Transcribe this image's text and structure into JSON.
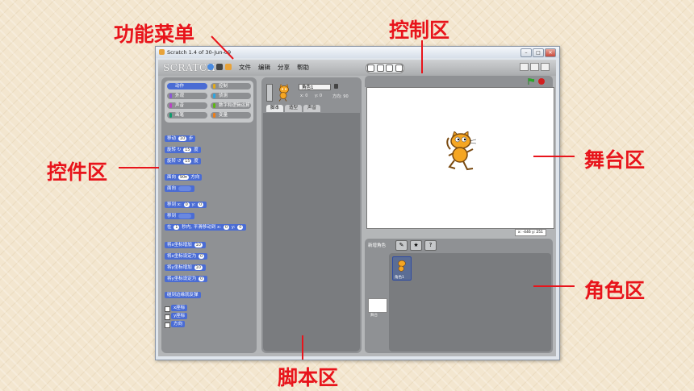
{
  "callouts": {
    "menu": "功能菜单",
    "control": "控制区",
    "blocks": "控件区",
    "stage": "舞台区",
    "sprites": "角色区",
    "scripts": "脚本区"
  },
  "window": {
    "title": "Scratch 1.4 of 30-Jun-09",
    "logo": "SCRATCH"
  },
  "menu": [
    "文件",
    "编辑",
    "分享",
    "帮助"
  ],
  "categories": [
    {
      "label": "动作",
      "color": "#4a6cd4",
      "selected": true
    },
    {
      "label": "控制",
      "color": "#e1a91a",
      "selected": false
    },
    {
      "label": "外观",
      "color": "#8a55d7",
      "selected": false
    },
    {
      "label": "侦测",
      "color": "#2ca5e2",
      "selected": false
    },
    {
      "label": "声音",
      "color": "#bb42c3",
      "selected": false
    },
    {
      "label": "数字和逻辑运算",
      "color": "#5cb712",
      "selected": false
    },
    {
      "label": "画笔",
      "color": "#0e9a6c",
      "selected": false
    },
    {
      "label": "变量",
      "color": "#ee7d16",
      "selected": false
    }
  ],
  "blocks": {
    "move": {
      "pre": "移动",
      "val": "10",
      "post": "步"
    },
    "turn_right": {
      "pre": "旋转 ↻",
      "val": "15",
      "post": "度"
    },
    "turn_left": {
      "pre": "旋转 ↺",
      "val": "15",
      "post": "度"
    },
    "point_dir": {
      "pre": "面向",
      "val": "90▾",
      "post": "方向"
    },
    "point_to": {
      "pre": "面向",
      "val": "",
      "post": ""
    },
    "goto_xy": {
      "pre": "移到 x:",
      "x": "0",
      "mid": "y:",
      "y": "0"
    },
    "goto": {
      "pre": "移到",
      "val": ""
    },
    "glide": {
      "pre": "在",
      "secs": "1",
      "mid": "秒内, 平滑移动到 x:",
      "x": "0",
      "ymid": "y:",
      "y": "0"
    },
    "change_x": {
      "pre": "将x坐标增加",
      "val": "10"
    },
    "set_x": {
      "pre": "将x坐标设定为",
      "val": "0"
    },
    "change_y": {
      "pre": "将y坐标增加",
      "val": "10"
    },
    "set_y": {
      "pre": "将y坐标设定为",
      "val": "0"
    },
    "bounce": {
      "pre": "碰到边缘就反弹"
    },
    "rep_x": "x座标",
    "rep_y": "y座标",
    "rep_dir": "方向"
  },
  "sprite_info": {
    "name": "角色1",
    "x_label": "x: 0",
    "y_label": "y: 0",
    "dir_label": "方向: 90"
  },
  "tabs": [
    "脚本",
    "造型",
    "声音"
  ],
  "stage": {
    "mouse_x": "x: -446",
    "mouse_y": "y: 251"
  },
  "sprites_panel": {
    "new_sprite": "新增角色",
    "sprite_name": "角色1",
    "stage_label": "舞台"
  },
  "colors": {
    "callout": "#e8141b",
    "motion": "#4a6cd4",
    "stop": "#d21f1f",
    "flag": "#2aa52a"
  }
}
